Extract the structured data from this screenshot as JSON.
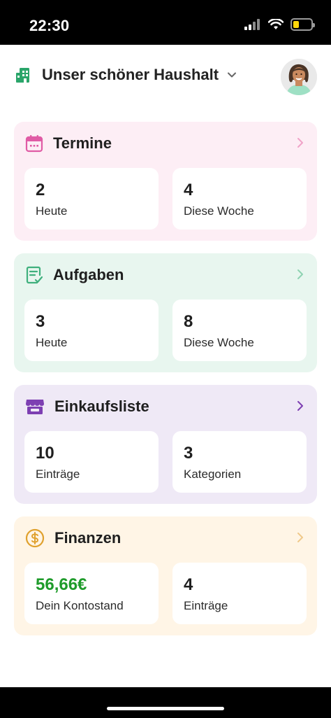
{
  "status_bar": {
    "time": "22:30",
    "battery_level": 0.35
  },
  "header": {
    "household_name": "Unser schöner Haushalt"
  },
  "colors": {
    "termine_bg": "#fdeef5",
    "termine_accent": "#e05ba5",
    "aufgaben_bg": "#e8f6ef",
    "aufgaben_accent": "#3fb07d",
    "einkauf_bg": "#efe9f6",
    "einkauf_accent": "#7d3fb2",
    "finanzen_bg": "#fff5e6",
    "finanzen_accent": "#e0a12e",
    "money_green": "#1e9b2a"
  },
  "cards": {
    "termine": {
      "title": "Termine",
      "left": {
        "value": "2",
        "label": "Heute"
      },
      "right": {
        "value": "4",
        "label": "Diese Woche"
      }
    },
    "aufgaben": {
      "title": "Aufgaben",
      "left": {
        "value": "3",
        "label": "Heute"
      },
      "right": {
        "value": "8",
        "label": "Diese Woche"
      }
    },
    "einkaufsliste": {
      "title": "Einkaufsliste",
      "left": {
        "value": "10",
        "label": "Einträge"
      },
      "right": {
        "value": "3",
        "label": "Kategorien"
      }
    },
    "finanzen": {
      "title": "Finanzen",
      "left": {
        "value": "56,66€",
        "label": "Dein Kontostand"
      },
      "right": {
        "value": "4",
        "label": "Einträge"
      }
    }
  },
  "icons": {
    "household": "building-icon",
    "dropdown": "chevron-down-icon",
    "termine": "calendar-icon",
    "aufgaben": "task-list-icon",
    "einkaufsliste": "store-icon",
    "finanzen": "dollar-icon",
    "chevron": "chevron-right-icon"
  }
}
